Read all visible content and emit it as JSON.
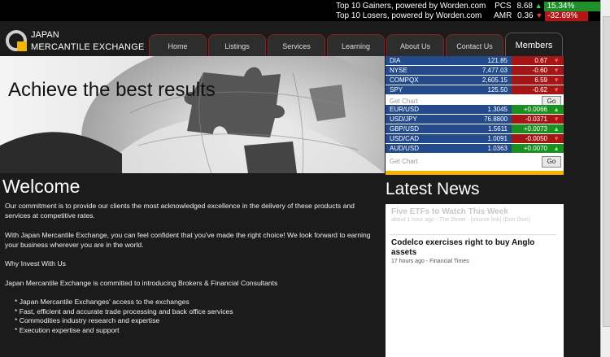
{
  "ticker": {
    "gainers_label": "Top 10 Gainers, powered by Worden.com",
    "gainers_symbol": "PCS",
    "gainers_value": "8.68",
    "gainers_change": "15.34%",
    "losers_label": "Top 10 Losers, powered by Worden.com",
    "losers_symbol": "AMR",
    "losers_value": "0.36",
    "losers_change": "-32.69%"
  },
  "logo": {
    "line1": "JAPAN",
    "line2": "MERCANTILE EXCHANGE"
  },
  "nav": [
    "Home",
    "Listings",
    "Services",
    "Learning",
    "About Us",
    "Contact Us",
    "Members"
  ],
  "hero": {
    "title": "Achieve the best results"
  },
  "quotes": [
    {
      "symbol": "DIA",
      "value": "121.85",
      "change": "0.67",
      "color": "red",
      "dir": "down"
    },
    {
      "symbol": "NYSE",
      "value": "7,477.03",
      "change": "-0.60",
      "color": "red",
      "dir": "down"
    },
    {
      "symbol": "COMPQX",
      "value": "2,605.15",
      "change": "6.59",
      "color": "red",
      "dir": "down"
    },
    {
      "symbol": "SPY",
      "value": "125.50",
      "change": "-0.62",
      "color": "red",
      "dir": "down"
    }
  ],
  "quote_lookup": {
    "placeholder": "Get Chart",
    "button": "Go"
  },
  "fx": [
    {
      "symbol": "EUR/USD",
      "value": "1.3045",
      "change": "+0.0066",
      "color": "green",
      "dir": "up"
    },
    {
      "symbol": "USD/JPY",
      "value": "76.8800",
      "change": "-0.0371",
      "color": "red",
      "dir": "down"
    },
    {
      "symbol": "GBP/USD",
      "value": "1.5611",
      "change": "+0.0073",
      "color": "green",
      "dir": "up"
    },
    {
      "symbol": "USD/CAD",
      "value": "1.0091",
      "change": "-0.0050",
      "color": "red",
      "dir": "down"
    },
    {
      "symbol": "AUD/USD",
      "value": "1.0363",
      "change": "+0.0070",
      "color": "green",
      "dir": "up"
    }
  ],
  "chart_lookup": {
    "placeholder": "Get Chart",
    "button": "Go"
  },
  "welcome": {
    "title": "Welcome",
    "p1": "Our commitment is to provide our clients the most acknowledged excellence in the delivery of these products and services at competitive rates.",
    "p2": "With Japan Mercantile Exchange, you can feel confident that you've made the right choice! We look forward to earning your business wherever you are in the world.",
    "h_why": "Why Invest With Us",
    "p3": "Japan Mercantile Exchange is committed to introducing Brokers & Financial Consultants",
    "bullets": [
      "Japan Mercantile Exchanges' access to the exchanges",
      "Fast, efficient and accurate trade processing and back office services",
      "Commodities industry research and expertise",
      "Execution expertise and support"
    ]
  },
  "news": {
    "title": "Latest News",
    "items": [
      {
        "headline": "Five ETFs to Watch This Week",
        "meta": "about 1 hour ago - The Street - [source link] (Don Dion)"
      },
      {
        "headline": "Codelco exercises right to buy Anglo assets",
        "meta": "17 hours ago - Financial Times"
      }
    ]
  },
  "colors": {
    "up": "#1c8f22",
    "down": "#a41616",
    "blue": "#234a8a",
    "accent": "#f2b600"
  }
}
